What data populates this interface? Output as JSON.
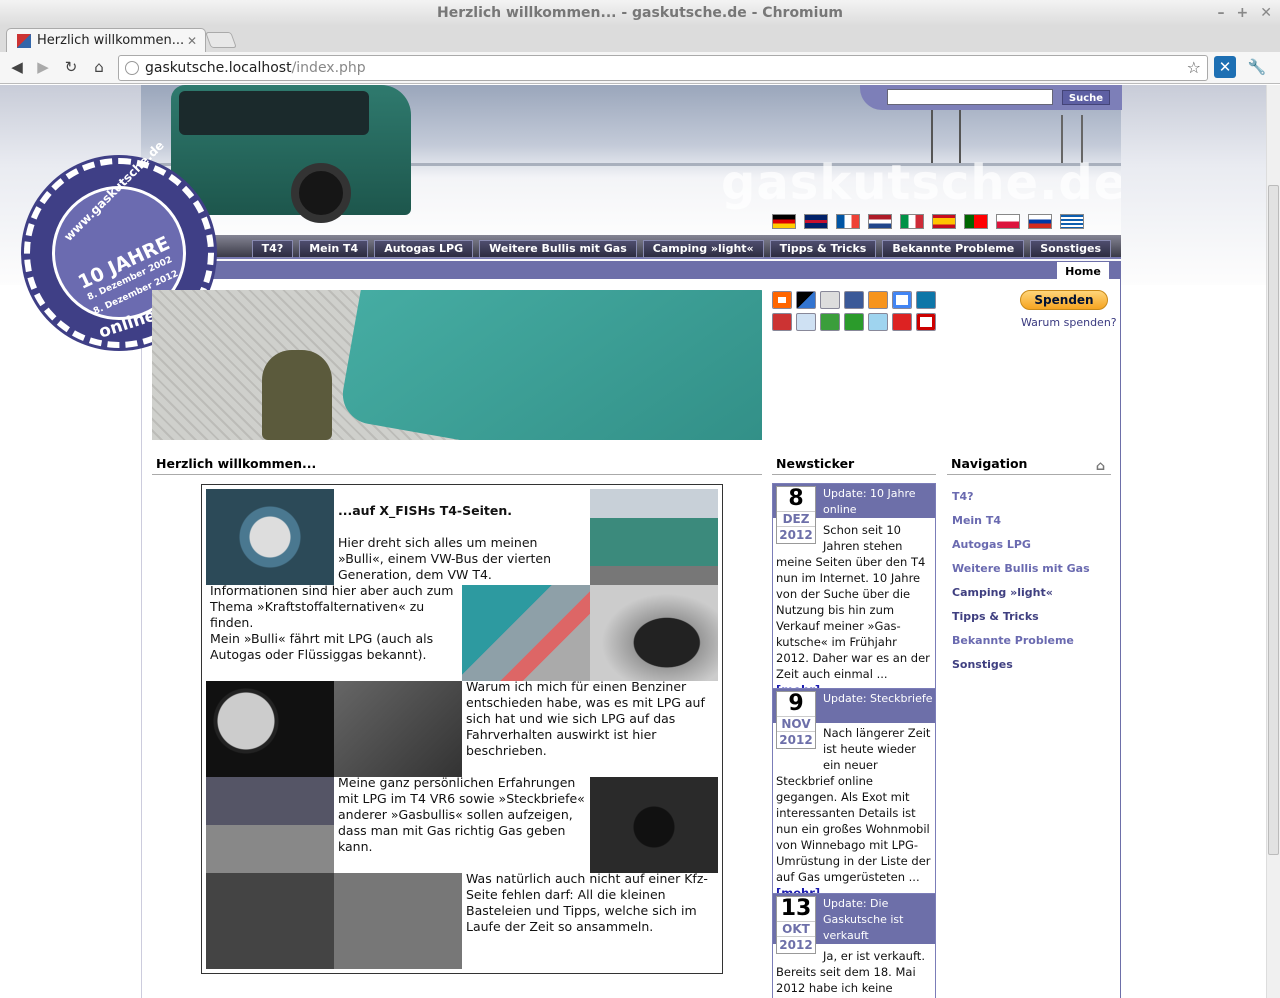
{
  "browser": {
    "window_title": "Herzlich willkommen... - gaskutsche.de - Chromium",
    "tab_title": "Herzlich willkommen...",
    "url_host": "gaskutsche.localhost",
    "url_path": "/index.php"
  },
  "header": {
    "brand": "gaskutsche.de",
    "search_button": "Suche",
    "flags": [
      "german-flag",
      "uk-flag",
      "french-flag",
      "dutch-flag",
      "italian-flag",
      "spanish-flag",
      "portuguese-flag",
      "polish-flag",
      "russian-flag",
      "greek-flag"
    ]
  },
  "menu": {
    "items": [
      "T4?",
      "Mein T4",
      "Autogas LPG",
      "Weitere Bullis mit Gas",
      "Camping »light«",
      "Tipps & Tricks",
      "Bekannte Probleme",
      "Sonstiges"
    ],
    "home_tab": "Home"
  },
  "seal": {
    "url": "www.gaskutsche.de",
    "years": "10 JAHRE",
    "date1": "8. Dezember 2002",
    "date2": "8. Dezember 2012",
    "online": "online"
  },
  "donate": {
    "button": "Spenden",
    "why": "Warum spenden?"
  },
  "intro": {
    "heading": "Herzlich willkommen...",
    "subtitle": "...auf X_FISHs T4-Seiten.",
    "p1": "Hier dreht sich alles um meinen »Bulli«, einem VW-Bus der vierten Generation, dem VW T4.",
    "p2": "Informationen sind hier aber auch zum Thema »Kraftstoffalternativen« zu finden.",
    "p3": "Mein »Bulli« fährt mit LPG (auch als Autogas oder Flüssiggas bekannt).",
    "p4": "Warum ich mich für einen Benziner entschieden habe, was es mit LPG auf sich hat und wie sich LPG auf das Fahrverhalten auswirkt ist hier beschrieben.",
    "p5": "Meine ganz persönlichen Erfahrungen mit LPG im T4 VR6 sowie »Steckbriefe« anderer »Gasbullis« sollen aufzeigen, dass man mit Gas richtig Gas geben kann.",
    "p6": "Was natürlich auch nicht auf einer Kfz-Seite fehlen darf: All die kleinen Basteleien und Tipps, welche sich im Laufe der Zeit so ansammeln."
  },
  "ticker": {
    "heading": "Newsticker",
    "more": "[mehr]",
    "items": [
      {
        "day": "8",
        "month": "DEZ",
        "year": "2012",
        "title": "Update: 10 Jahre online",
        "body_a": "Schon seit 10 Jahren stehen",
        "body_b": "meine Seiten über den T4 nun im Internet. 10 Jahre von der Suche über die Nutzung bis hin zum Verkauf meiner »Gas-kutsche« im Frühjahr 2012. Daher war es an der Zeit auch einmal ..."
      },
      {
        "day": "9",
        "month": "NOV",
        "year": "2012",
        "title": "Update: Steckbriefe",
        "body_a": "Nach längerer Zeit ist heute wieder ein neuer",
        "body_b": "Steckbrief online gegangen. Als Exot mit interessanten Details ist nun ein großes Wohnmobil von Winnebago mit LPG-Umrüstung in der Liste der auf Gas umgerüsteten ..."
      },
      {
        "day": "13",
        "month": "OKT",
        "year": "2012",
        "title": "Update: Die Gaskutsche ist verkauft",
        "body_a": "Ja, er ist verkauft.",
        "body_b": "Bereits seit dem 18. Mai 2012 habe ich keine"
      }
    ]
  },
  "navigation": {
    "heading": "Navigation",
    "items": [
      "T4?",
      "Mein T4",
      "Autogas LPG",
      "Weitere Bullis mit Gas",
      "Camping »light«",
      "Tipps & Tricks",
      "Bekannte Probleme",
      "Sonstiges"
    ]
  },
  "colors": {
    "accent": "#6d6fa9",
    "menu_dark": "#3a3a47",
    "link": "#6a6ab0"
  }
}
